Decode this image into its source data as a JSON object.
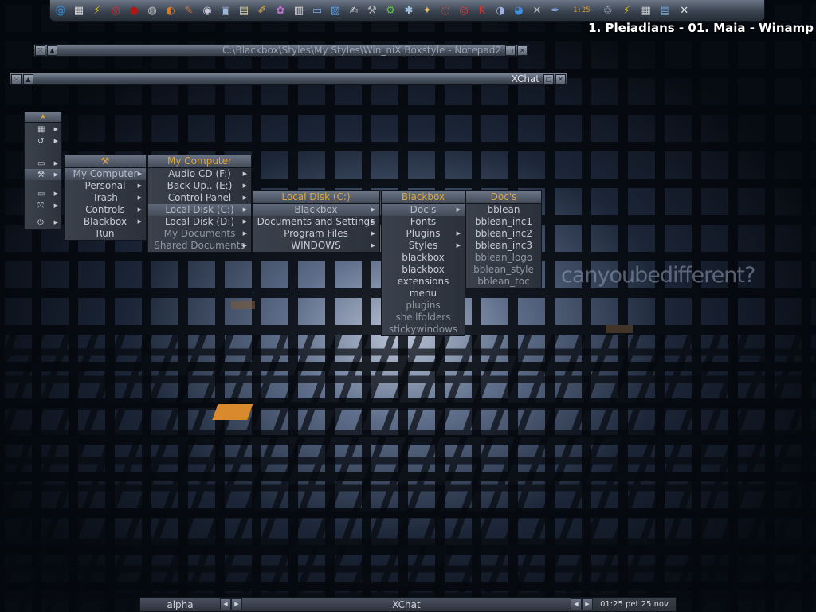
{
  "desktop": {
    "slogan": "canyoubedifferent?"
  },
  "toolbar": {
    "icons": [
      {
        "name": "launcher-icon",
        "glyph": "@",
        "color": "#2f8fd8"
      },
      {
        "name": "calendar-icon",
        "glyph": "▦",
        "color": "#d9d9d9"
      },
      {
        "name": "lightning-icon",
        "glyph": "⚡",
        "color": "#e6c020"
      },
      {
        "name": "lifebuoy-icon",
        "glyph": "◎",
        "color": "#d83030"
      },
      {
        "name": "stop-icon",
        "glyph": "●",
        "color": "#b01818"
      },
      {
        "name": "rss-icon",
        "glyph": "◍",
        "color": "#c0c0c0"
      },
      {
        "name": "firefox-icon",
        "glyph": "◐",
        "color": "#e07a20"
      },
      {
        "name": "gimp-icon",
        "glyph": "✎",
        "color": "#d07040"
      },
      {
        "name": "cd-icon",
        "glyph": "◉",
        "color": "#c8c8d8"
      },
      {
        "name": "cube-icon",
        "glyph": "▣",
        "color": "#a0b8d8"
      },
      {
        "name": "folder-icon",
        "glyph": "▤",
        "color": "#d8d0a0"
      },
      {
        "name": "paint-icon",
        "glyph": "✐",
        "color": "#e0b040"
      },
      {
        "name": "palette-icon",
        "glyph": "✿",
        "color": "#c070d0"
      },
      {
        "name": "film-icon",
        "glyph": "▥",
        "color": "#e0e0e0"
      },
      {
        "name": "monitor-icon",
        "glyph": "▭",
        "color": "#7fa8e0"
      },
      {
        "name": "picture-icon",
        "glyph": "▨",
        "color": "#60a0e0"
      },
      {
        "name": "edit-icon",
        "glyph": "✍",
        "color": "#d0d0d0"
      },
      {
        "name": "tools-icon",
        "glyph": "⚒",
        "color": "#b0b0b0"
      },
      {
        "name": "gear-icon",
        "glyph": "⚙",
        "color": "#60c040"
      },
      {
        "name": "settings-icon",
        "glyph": "✱",
        "color": "#a0c0e0"
      },
      {
        "name": "wand-icon",
        "glyph": "✦",
        "color": "#e0c060"
      },
      {
        "name": "ring-icon",
        "glyph": "◌",
        "color": "#e05030"
      },
      {
        "name": "target-icon",
        "glyph": "◎",
        "color": "#e04040"
      },
      {
        "name": "k-icon",
        "glyph": "K",
        "color": "#e03030"
      },
      {
        "name": "globe-icon",
        "glyph": "◑",
        "color": "#a0b0e0"
      },
      {
        "name": "earth-icon",
        "glyph": "◕",
        "color": "#4090e0"
      },
      {
        "name": "tweezers-icon",
        "glyph": "✕",
        "color": "#c0c0c0"
      },
      {
        "name": "pen-icon",
        "glyph": "✒",
        "color": "#80a0e0"
      }
    ],
    "clock": "1:25",
    "tray_icons": [
      {
        "name": "recycle-bin-icon",
        "glyph": "♲",
        "color": "#d0d8e8"
      },
      {
        "name": "tray-lightning-icon",
        "glyph": "⚡",
        "color": "#e6c020"
      },
      {
        "name": "screens-icon",
        "glyph": "▦",
        "color": "#d0d0d0"
      },
      {
        "name": "notes-icon",
        "glyph": "▤",
        "color": "#80b0e0"
      },
      {
        "name": "tray-tools-icon",
        "glyph": "✕",
        "color": "#e0e0e0"
      }
    ]
  },
  "now_playing": "1. Pleiadians - 01. Maia - Winamp",
  "windows": {
    "notepad_title": "C:\\Blackbox\\Styles\\My Styles\\Win_niX Boxstyle - Notepad2",
    "xchat_title": "XChat"
  },
  "icon_menu": {
    "head_glyph": "★",
    "rows": [
      {
        "name": "programs-icon",
        "glyph": "▦"
      },
      {
        "name": "recent-icon",
        "glyph": "↺"
      },
      {
        "name": "open-folder-icon",
        "glyph": "▭"
      },
      {
        "name": "tools-menu-icon",
        "glyph": "⚒"
      },
      {
        "name": "windows-icon",
        "glyph": "▭"
      },
      {
        "name": "swap-icon",
        "glyph": "⤧"
      },
      {
        "name": "power-icon",
        "glyph": "⏻"
      }
    ]
  },
  "menus": {
    "tools": {
      "head_glyph": "⚒",
      "items": [
        "My Computer",
        "Personal",
        "Trash",
        "Controls",
        "Blackbox",
        "Run"
      ]
    },
    "my_computer": {
      "title": "My Computer",
      "items": [
        "Audio CD (F:)",
        "Back Up.. (E:)",
        "Control Panel",
        "Local Disk (C:)",
        "Local Disk (D:)",
        "My Documents",
        "Shared Documents"
      ]
    },
    "local_disk": {
      "title": "Local Disk (C:)",
      "items": [
        "Blackbox",
        "Documents and Settings",
        "Program Files",
        "WINDOWS"
      ]
    },
    "blackbox": {
      "title": "Blackbox",
      "items": [
        "Doc's",
        "Fonts",
        "Plugins",
        "Styles",
        "blackbox",
        "blackbox",
        "extensions",
        "menu",
        "plugins",
        "shellfolders",
        "stickywindows"
      ]
    },
    "docs": {
      "title": "Doc's",
      "items": [
        "bblean",
        "bblean_inc1",
        "bblean_inc2",
        "bblean_inc3",
        "bblean_logo",
        "bblean_style",
        "bblean_toc"
      ]
    }
  },
  "taskbar": {
    "workspace": "alpha",
    "task": "XChat",
    "clock": "01:25 pet 25 nov"
  }
}
